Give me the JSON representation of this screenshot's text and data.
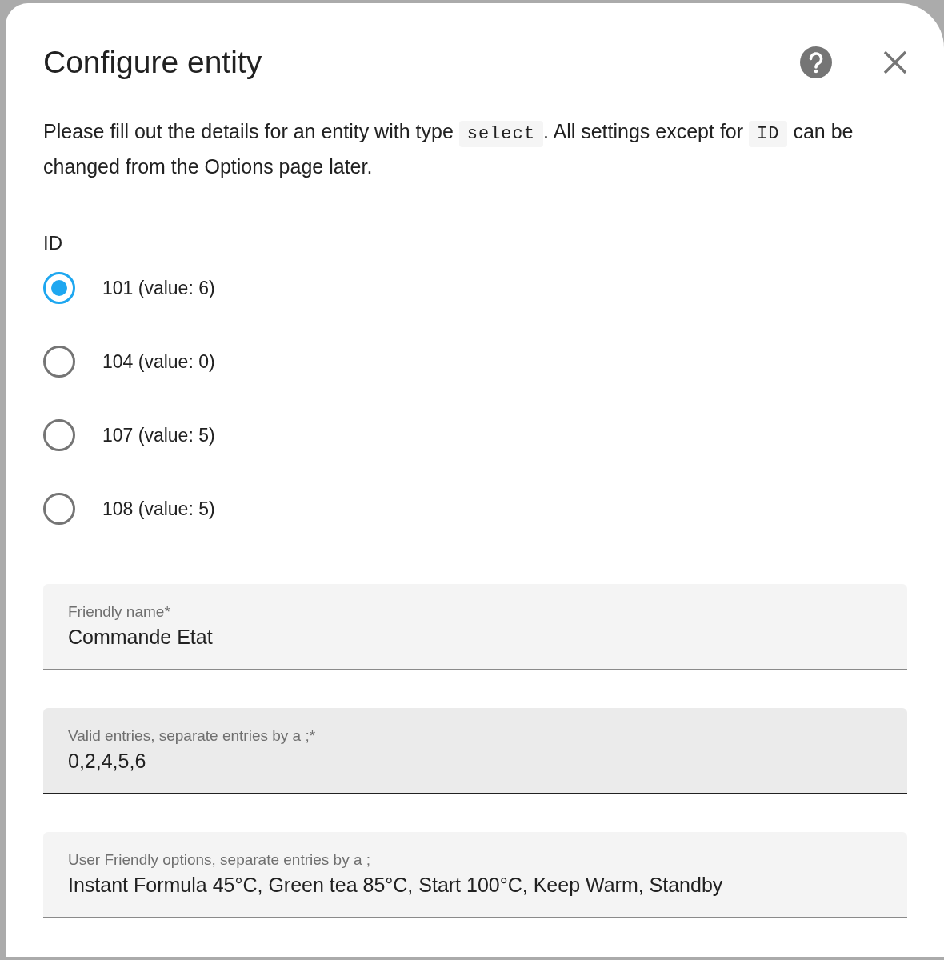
{
  "dialog": {
    "title": "Configure entity",
    "description": [
      {
        "kind": "text",
        "text": "Please fill out the details for an entity with type "
      },
      {
        "kind": "code",
        "text": "select"
      },
      {
        "kind": "text",
        "text": ". All settings except for "
      },
      {
        "kind": "code",
        "text": "ID"
      },
      {
        "kind": "text",
        "text": " can be changed from the Options page later."
      }
    ],
    "id_group": {
      "label": "ID",
      "options": [
        {
          "label": "101 (value: 6)",
          "selected": true
        },
        {
          "label": "104 (value: 0)",
          "selected": false
        },
        {
          "label": "107 (value: 5)",
          "selected": false
        },
        {
          "label": "108 (value: 5)",
          "selected": false
        }
      ]
    },
    "fields": [
      {
        "label": "Friendly name*",
        "value": "Commande Etat",
        "focused": false
      },
      {
        "label": "Valid entries, separate entries by a ;*",
        "value": "0,2,4,5,6",
        "focused": true
      },
      {
        "label": "User Friendly options, separate entries by a ;",
        "value": "Instant Formula 45°C, Green tea 85°C, Start 100°C, Keep Warm, Standby",
        "focused": false
      }
    ]
  }
}
